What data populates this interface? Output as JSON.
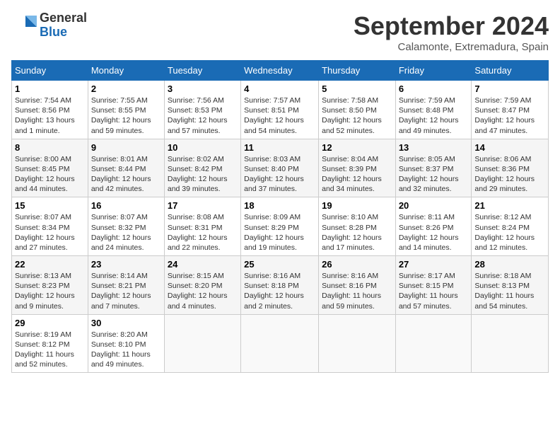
{
  "header": {
    "logo_general": "General",
    "logo_blue": "Blue",
    "month_title": "September 2024",
    "location": "Calamonte, Extremadura, Spain"
  },
  "columns": [
    "Sunday",
    "Monday",
    "Tuesday",
    "Wednesday",
    "Thursday",
    "Friday",
    "Saturday"
  ],
  "weeks": [
    [
      {
        "day": "1",
        "info": "Sunrise: 7:54 AM\nSunset: 8:56 PM\nDaylight: 13 hours and 1 minute."
      },
      {
        "day": "2",
        "info": "Sunrise: 7:55 AM\nSunset: 8:55 PM\nDaylight: 12 hours and 59 minutes."
      },
      {
        "day": "3",
        "info": "Sunrise: 7:56 AM\nSunset: 8:53 PM\nDaylight: 12 hours and 57 minutes."
      },
      {
        "day": "4",
        "info": "Sunrise: 7:57 AM\nSunset: 8:51 PM\nDaylight: 12 hours and 54 minutes."
      },
      {
        "day": "5",
        "info": "Sunrise: 7:58 AM\nSunset: 8:50 PM\nDaylight: 12 hours and 52 minutes."
      },
      {
        "day": "6",
        "info": "Sunrise: 7:59 AM\nSunset: 8:48 PM\nDaylight: 12 hours and 49 minutes."
      },
      {
        "day": "7",
        "info": "Sunrise: 7:59 AM\nSunset: 8:47 PM\nDaylight: 12 hours and 47 minutes."
      }
    ],
    [
      {
        "day": "8",
        "info": "Sunrise: 8:00 AM\nSunset: 8:45 PM\nDaylight: 12 hours and 44 minutes."
      },
      {
        "day": "9",
        "info": "Sunrise: 8:01 AM\nSunset: 8:44 PM\nDaylight: 12 hours and 42 minutes."
      },
      {
        "day": "10",
        "info": "Sunrise: 8:02 AM\nSunset: 8:42 PM\nDaylight: 12 hours and 39 minutes."
      },
      {
        "day": "11",
        "info": "Sunrise: 8:03 AM\nSunset: 8:40 PM\nDaylight: 12 hours and 37 minutes."
      },
      {
        "day": "12",
        "info": "Sunrise: 8:04 AM\nSunset: 8:39 PM\nDaylight: 12 hours and 34 minutes."
      },
      {
        "day": "13",
        "info": "Sunrise: 8:05 AM\nSunset: 8:37 PM\nDaylight: 12 hours and 32 minutes."
      },
      {
        "day": "14",
        "info": "Sunrise: 8:06 AM\nSunset: 8:36 PM\nDaylight: 12 hours and 29 minutes."
      }
    ],
    [
      {
        "day": "15",
        "info": "Sunrise: 8:07 AM\nSunset: 8:34 PM\nDaylight: 12 hours and 27 minutes."
      },
      {
        "day": "16",
        "info": "Sunrise: 8:07 AM\nSunset: 8:32 PM\nDaylight: 12 hours and 24 minutes."
      },
      {
        "day": "17",
        "info": "Sunrise: 8:08 AM\nSunset: 8:31 PM\nDaylight: 12 hours and 22 minutes."
      },
      {
        "day": "18",
        "info": "Sunrise: 8:09 AM\nSunset: 8:29 PM\nDaylight: 12 hours and 19 minutes."
      },
      {
        "day": "19",
        "info": "Sunrise: 8:10 AM\nSunset: 8:28 PM\nDaylight: 12 hours and 17 minutes."
      },
      {
        "day": "20",
        "info": "Sunrise: 8:11 AM\nSunset: 8:26 PM\nDaylight: 12 hours and 14 minutes."
      },
      {
        "day": "21",
        "info": "Sunrise: 8:12 AM\nSunset: 8:24 PM\nDaylight: 12 hours and 12 minutes."
      }
    ],
    [
      {
        "day": "22",
        "info": "Sunrise: 8:13 AM\nSunset: 8:23 PM\nDaylight: 12 hours and 9 minutes."
      },
      {
        "day": "23",
        "info": "Sunrise: 8:14 AM\nSunset: 8:21 PM\nDaylight: 12 hours and 7 minutes."
      },
      {
        "day": "24",
        "info": "Sunrise: 8:15 AM\nSunset: 8:20 PM\nDaylight: 12 hours and 4 minutes."
      },
      {
        "day": "25",
        "info": "Sunrise: 8:16 AM\nSunset: 8:18 PM\nDaylight: 12 hours and 2 minutes."
      },
      {
        "day": "26",
        "info": "Sunrise: 8:16 AM\nSunset: 8:16 PM\nDaylight: 11 hours and 59 minutes."
      },
      {
        "day": "27",
        "info": "Sunrise: 8:17 AM\nSunset: 8:15 PM\nDaylight: 11 hours and 57 minutes."
      },
      {
        "day": "28",
        "info": "Sunrise: 8:18 AM\nSunset: 8:13 PM\nDaylight: 11 hours and 54 minutes."
      }
    ],
    [
      {
        "day": "29",
        "info": "Sunrise: 8:19 AM\nSunset: 8:12 PM\nDaylight: 11 hours and 52 minutes."
      },
      {
        "day": "30",
        "info": "Sunrise: 8:20 AM\nSunset: 8:10 PM\nDaylight: 11 hours and 49 minutes."
      },
      {
        "day": "",
        "info": ""
      },
      {
        "day": "",
        "info": ""
      },
      {
        "day": "",
        "info": ""
      },
      {
        "day": "",
        "info": ""
      },
      {
        "day": "",
        "info": ""
      }
    ]
  ]
}
